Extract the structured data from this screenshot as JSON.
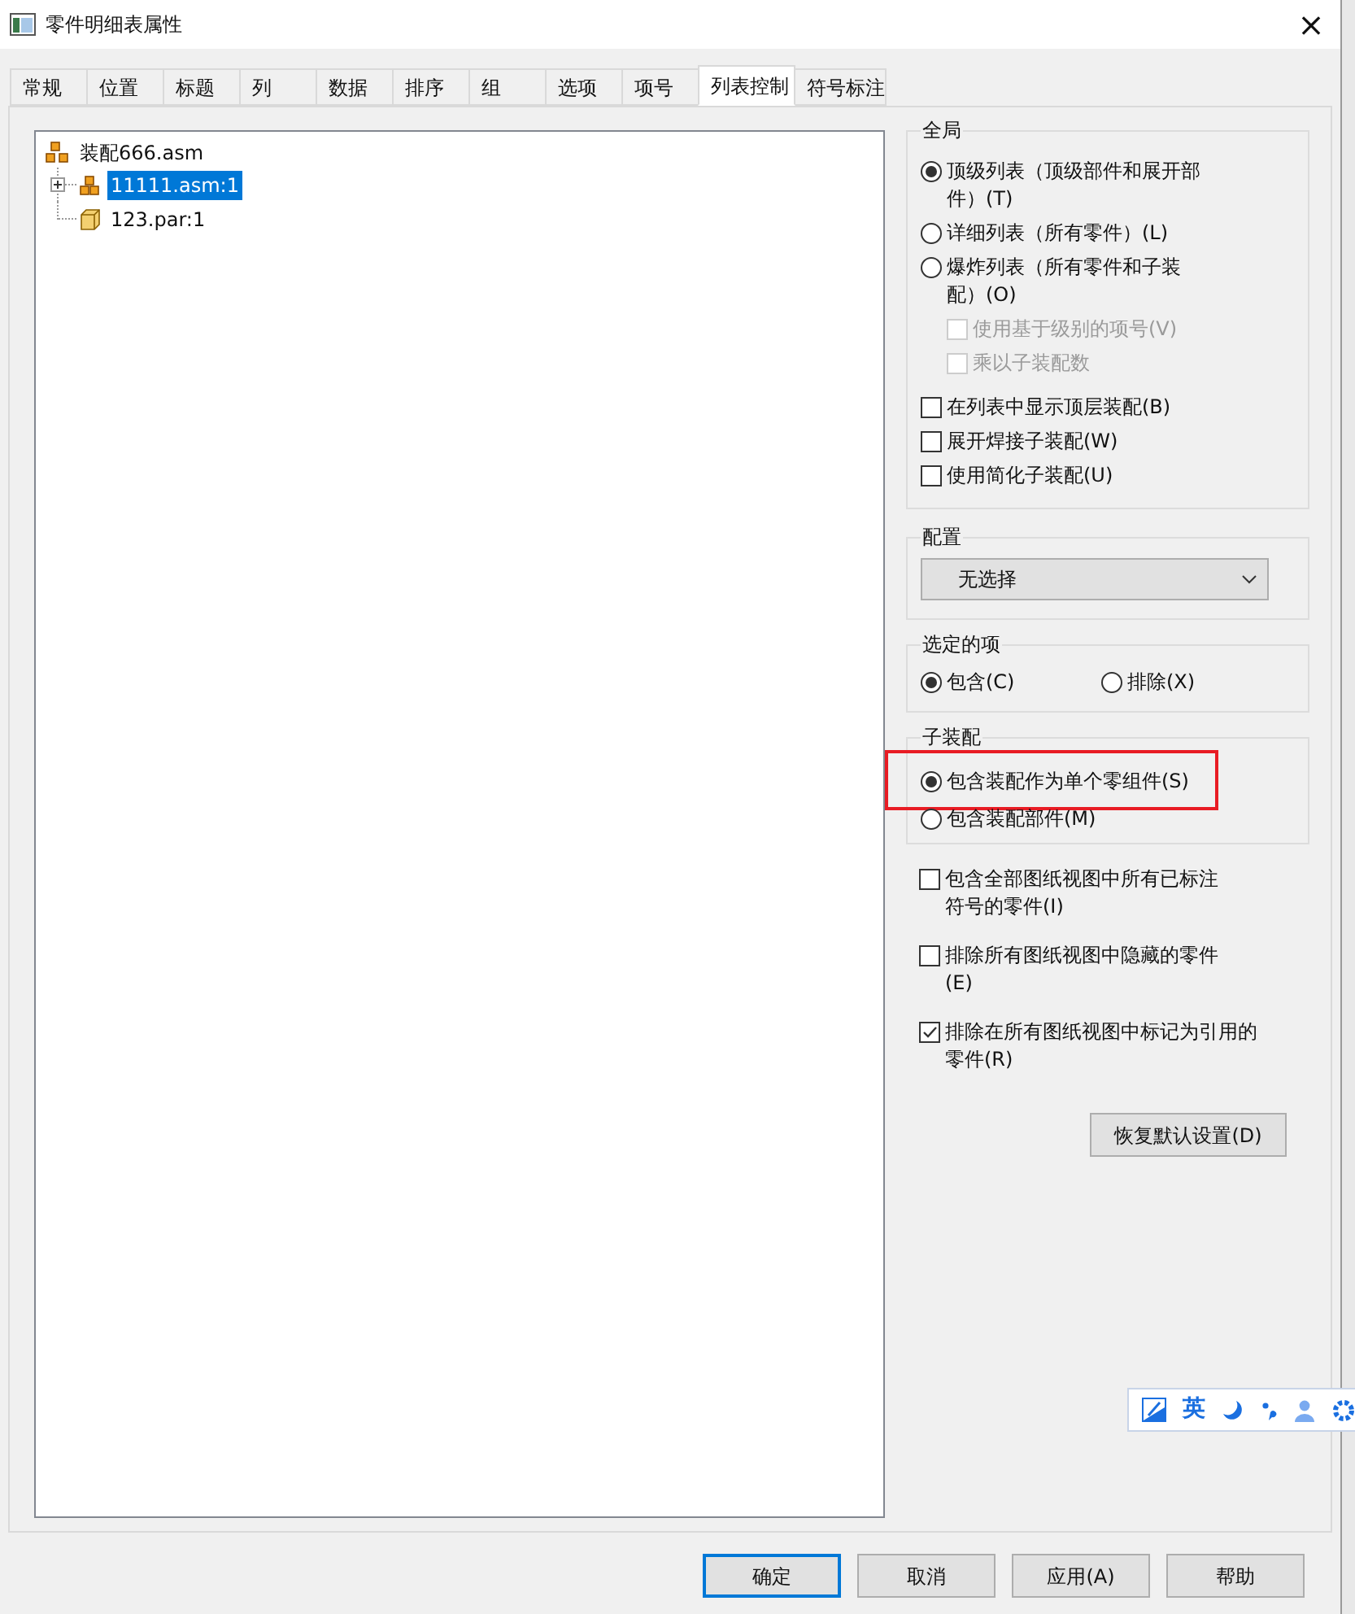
{
  "window": {
    "title": "零件明细表属性",
    "close": "×"
  },
  "tabs": [
    {
      "label": "常规",
      "selected": false
    },
    {
      "label": "位置",
      "selected": false
    },
    {
      "label": "标题",
      "selected": false
    },
    {
      "label": "列",
      "selected": false
    },
    {
      "label": "数据",
      "selected": false
    },
    {
      "label": "排序",
      "selected": false
    },
    {
      "label": "组",
      "selected": false
    },
    {
      "label": "选项",
      "selected": false
    },
    {
      "label": "项号",
      "selected": false
    },
    {
      "label": "列表控制",
      "selected": true
    },
    {
      "label": "符号标注",
      "selected": false
    }
  ],
  "tree": [
    {
      "label": "装配666.asm",
      "kind": "assembly",
      "selected": false,
      "children": [
        {
          "label": "11111.asm:1",
          "kind": "subassembly",
          "selected": true,
          "expandable": true
        },
        {
          "label": "123.par:1",
          "kind": "part",
          "selected": false,
          "expandable": false
        }
      ]
    }
  ],
  "global_group": {
    "title": "全局",
    "items": [
      {
        "kind": "radio",
        "label": "顶级列表（顶级部件和展开部件）(T)",
        "selected": true
      },
      {
        "kind": "radio",
        "label": "详细列表（所有零件）(L)",
        "selected": false
      },
      {
        "kind": "radio",
        "label": "爆炸列表（所有零件和子装配）(O)",
        "selected": false,
        "children": [
          {
            "kind": "checkbox",
            "label": "使用基于级别的项号(V)",
            "checked": false,
            "disabled": true
          },
          {
            "kind": "checkbox",
            "label": "乘以子装配数",
            "checked": false,
            "disabled": true
          }
        ]
      },
      {
        "kind": "checkbox",
        "label": "在列表中显示顶层装配(B)",
        "checked": false,
        "disabled": false
      },
      {
        "kind": "checkbox",
        "label": "展开焊接子装配(W)",
        "checked": false,
        "disabled": false
      },
      {
        "kind": "checkbox",
        "label": "使用简化子装配(U)",
        "checked": false,
        "disabled": false
      }
    ]
  },
  "config_group": {
    "title": "配置",
    "dropdown": "无选择"
  },
  "selected_items_group": {
    "title": "选定的项",
    "options": [
      {
        "label": "包含(C)",
        "selected": true
      },
      {
        "label": "排除(X)",
        "selected": false
      }
    ]
  },
  "subassembly_group": {
    "title": "子装配",
    "options": [
      {
        "label": "包含装配作为单个零组件(S)",
        "selected": true,
        "highlighted": true
      },
      {
        "label": "包含装配部件(M)",
        "selected": false,
        "highlighted": false
      }
    ]
  },
  "options": [
    {
      "label": "包含全部图纸视图中所有已标注符号的零件(I)",
      "checked": false
    },
    {
      "label": "排除所有图纸视图中隐藏的零件(E)",
      "checked": false
    },
    {
      "label": "排除在所有图纸视图中标记为引用的零件(R)",
      "checked": true
    }
  ],
  "restore_button": "恢复默认设置(D)",
  "buttons": [
    {
      "label": "确定",
      "default": true
    },
    {
      "label": "取消",
      "default": false
    },
    {
      "label": "应用(A)",
      "default": false
    },
    {
      "label": "帮助",
      "default": false
    }
  ],
  "ime_toolbar": {
    "language": "英"
  }
}
